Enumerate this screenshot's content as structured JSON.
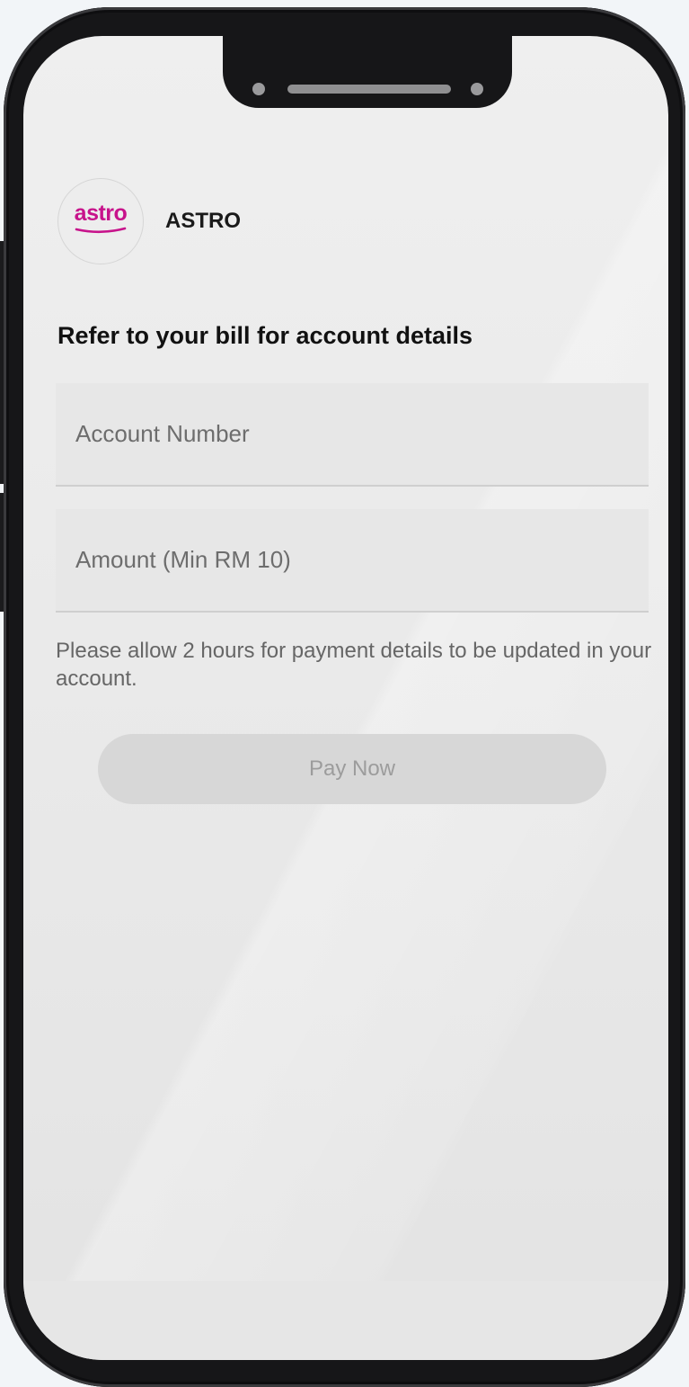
{
  "biller": {
    "logo_text": "astro",
    "name": "ASTRO",
    "brand_color": "#c7138b"
  },
  "form": {
    "title": "Refer to your bill for account details",
    "account_number": {
      "value": "",
      "placeholder": "Account Number"
    },
    "amount": {
      "value": "",
      "placeholder": "Amount (Min RM 10)"
    },
    "hint": "Please allow 2 hours for payment details to be updated in your account.",
    "submit_label": "Pay Now",
    "submit_enabled": false
  }
}
